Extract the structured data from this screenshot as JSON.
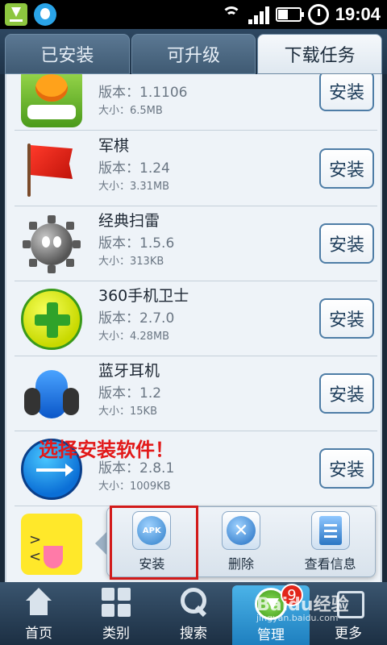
{
  "status_bar": {
    "time": "19:04"
  },
  "tabs": [
    {
      "label": "已安装"
    },
    {
      "label": "可升级"
    },
    {
      "label": "下载任务"
    }
  ],
  "apps": [
    {
      "name": "",
      "version": "版本：1.1106",
      "size": "大小：6.5MB",
      "icon": "game-icon",
      "button": "安装"
    },
    {
      "name": "军棋",
      "version": "版本：1.24",
      "size": "大小：3.31MB",
      "icon": "flag-icon",
      "button": "安装"
    },
    {
      "name": "经典扫雷",
      "version": "版本：1.5.6",
      "size": "大小：313KB",
      "icon": "minesweeper-icon",
      "button": "安装"
    },
    {
      "name": "360手机卫士",
      "version": "版本：2.7.0",
      "size": "大小：4.28MB",
      "icon": "360-shield-icon",
      "button": "安装"
    },
    {
      "name": "蓝牙耳机",
      "version": "版本：1.2",
      "size": "大小：15KB",
      "icon": "bluetooth-headset-icon",
      "button": "安装"
    },
    {
      "name": "",
      "version": "版本：2.8.1",
      "size": "大小：1009KB",
      "icon": "usb-icon",
      "button": "安装"
    }
  ],
  "overlay_text": "选择安装软件！",
  "popup": {
    "items": [
      {
        "label": "安装",
        "icon": "apk-install-icon"
      },
      {
        "label": "删除",
        "icon": "delete-icon"
      },
      {
        "label": "查看信息",
        "icon": "info-doc-icon"
      }
    ],
    "apk_text": "APK",
    "delete_glyph": "✕"
  },
  "bottom_nav": [
    {
      "label": "首页"
    },
    {
      "label": "类别"
    },
    {
      "label": "搜索"
    },
    {
      "label": "管理",
      "badge": "9"
    },
    {
      "label": "更多"
    }
  ],
  "watermark": {
    "text": "Baidu经验",
    "url": "jingyan.baidu.com"
  },
  "colors": {
    "highlight": "#d21a1a",
    "overlay_text": "#e21919",
    "tab_bar": "#2d4761"
  }
}
